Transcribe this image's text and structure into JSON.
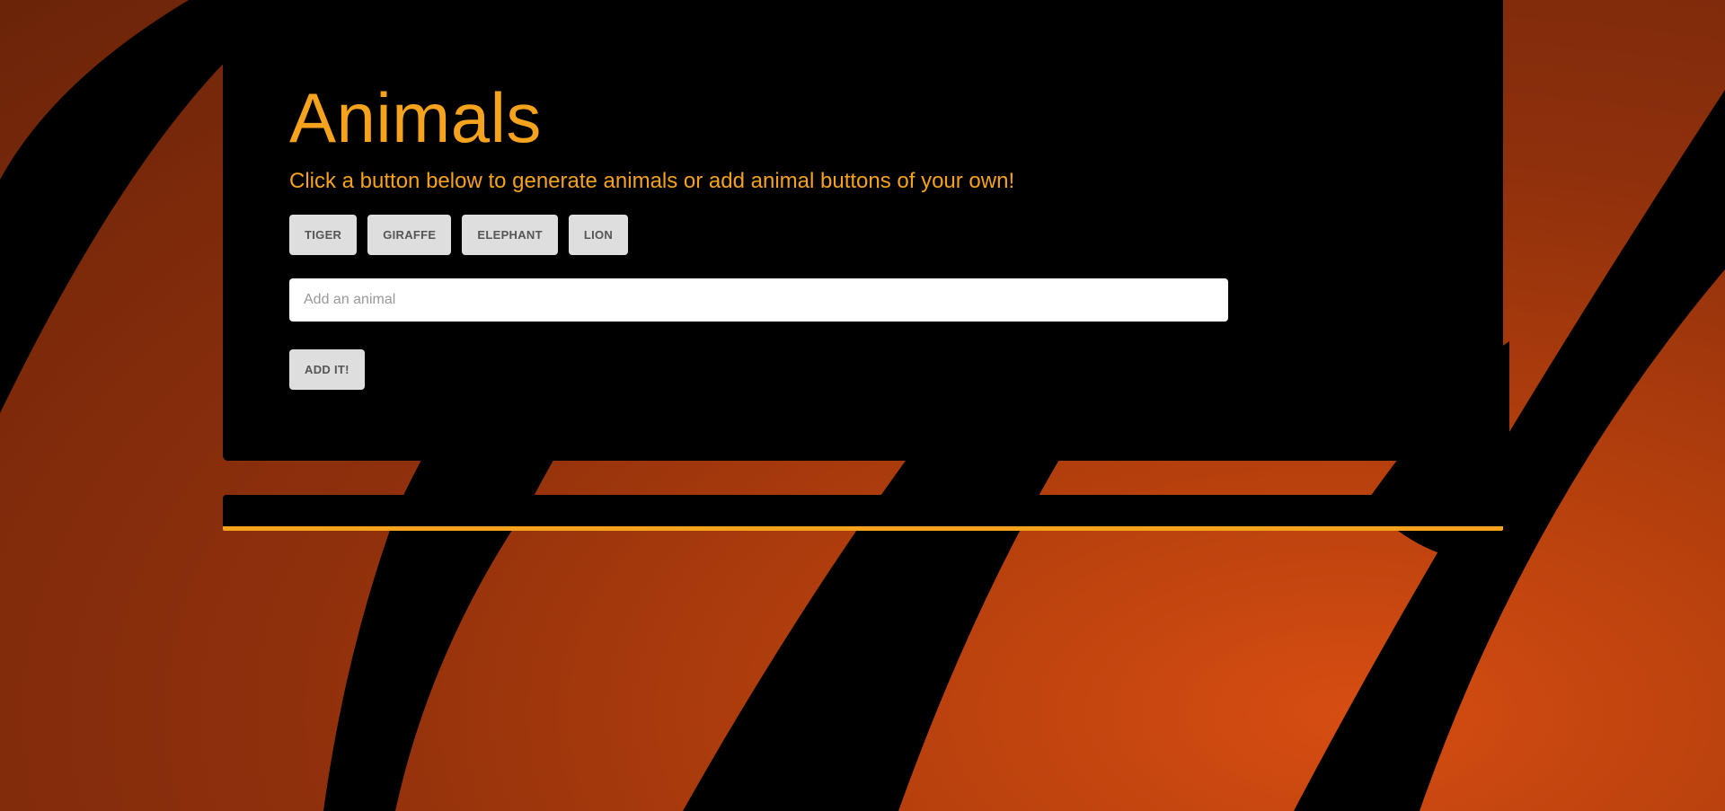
{
  "page": {
    "title": "Animals",
    "subtitle": "Click a button below to generate animals or add animal buttons of your own!"
  },
  "animal_buttons": [
    {
      "label": "TIGER"
    },
    {
      "label": "GIRAFFE"
    },
    {
      "label": "ELEPHANT"
    },
    {
      "label": "LION"
    }
  ],
  "form": {
    "input_placeholder": "Add an animal",
    "input_value": "",
    "submit_label": "ADD IT!"
  },
  "colors": {
    "accent": "#f5a21c",
    "panel": "#000000",
    "button_bg": "#dedede",
    "button_text": "#555555",
    "background_orange": "#c4450f"
  },
  "background": {
    "theme": "tiger-stripes"
  }
}
